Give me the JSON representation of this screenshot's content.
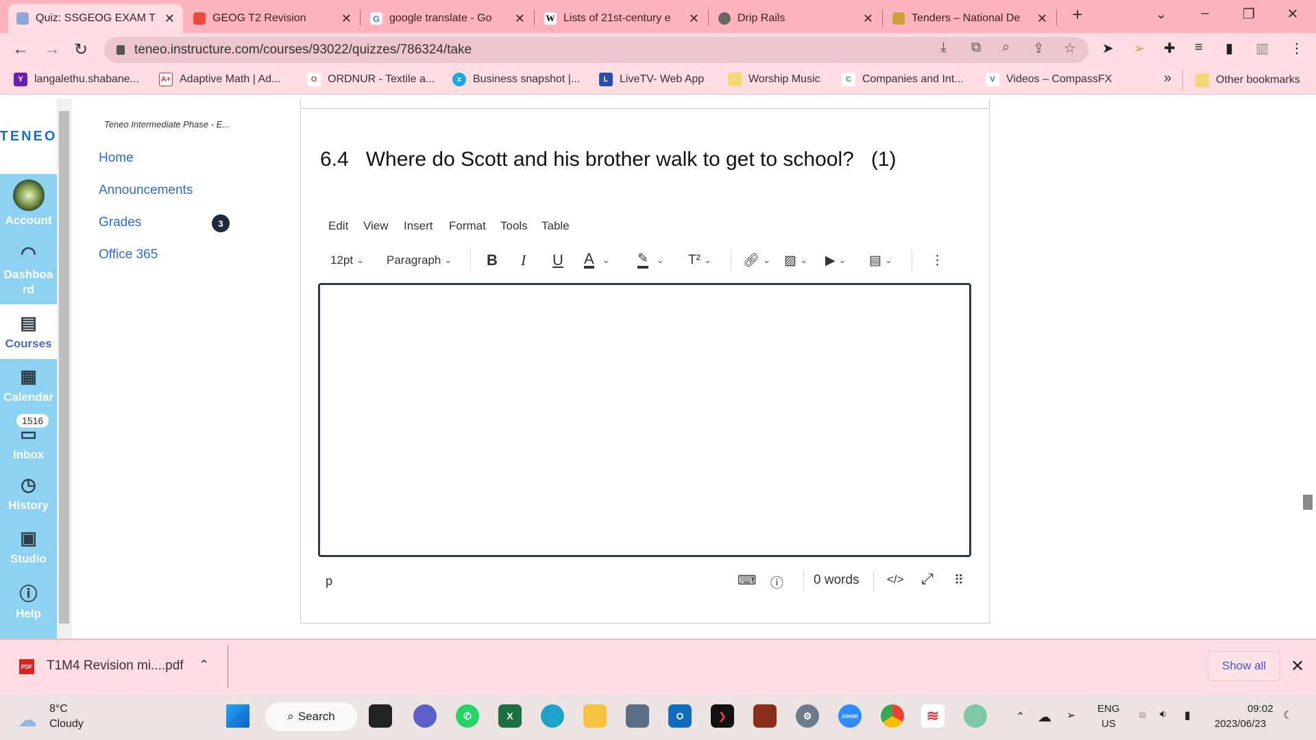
{
  "browser": {
    "tabs": [
      {
        "title": "Quiz: SSGEOG EXAM T",
        "active": true,
        "color": "#8fa7d8"
      },
      {
        "title": "GEOG T2 Revision",
        "active": false,
        "color": "#e84c3d"
      },
      {
        "title": "google translate - Go",
        "active": false,
        "color": "#4285f4"
      },
      {
        "title": "Lists of 21st-century e",
        "active": false,
        "color": "#ffffff"
      },
      {
        "title": "Drip Rails",
        "active": false,
        "color": "#666666"
      },
      {
        "title": "Tenders – National De",
        "active": false,
        "color": "#c9a13b"
      }
    ],
    "new_tab": "+",
    "url": "teneo.instructure.com/courses/93022/quizzes/786324/take",
    "bookmarks": [
      {
        "label": "langalethu.shabane...",
        "color": "#6b1fb1",
        "glyph": "Y"
      },
      {
        "label": "Adaptive Math | Ad...",
        "color": "#d32f2f",
        "glyph": "A+"
      },
      {
        "label": "ORDNUR - Textile a...",
        "color": "#8a5a3b",
        "glyph": "O"
      },
      {
        "label": "Business snapshot |...",
        "color": "#18a9e0",
        "glyph": "x"
      },
      {
        "label": "LiveTV- Web App",
        "color": "#2a4fb0",
        "glyph": "L"
      },
      {
        "label": "Worship Music",
        "color": "#f7d774",
        "glyph": ""
      },
      {
        "label": "Companies and Int...",
        "color": "#3da24a",
        "glyph": "C"
      },
      {
        "label": "Videos – CompassFX",
        "color": "#3a6fb0",
        "glyph": "V"
      }
    ],
    "more_bookmarks": "»",
    "other_bookmarks": "Other bookmarks"
  },
  "canvas": {
    "logo": "TENEO",
    "global_nav": [
      {
        "label": "Account",
        "icon": "avatar"
      },
      {
        "label": "Dashboard",
        "icon": "dashboard-icon"
      },
      {
        "label": "Courses",
        "icon": "courses-icon",
        "active": true
      },
      {
        "label": "Calendar",
        "icon": "calendar-icon"
      },
      {
        "label": "Inbox",
        "icon": "inbox-icon",
        "badge": "1516"
      },
      {
        "label": "History",
        "icon": "history-icon"
      },
      {
        "label": "Studio",
        "icon": "studio-icon"
      },
      {
        "label": "Help",
        "icon": "help-icon"
      }
    ],
    "course_title": "Teneo Intermediate Phase - E...",
    "course_nav": [
      {
        "label": "Home"
      },
      {
        "label": "Announcements"
      },
      {
        "label": "Grades",
        "badge": "3"
      },
      {
        "label": "Office 365"
      }
    ]
  },
  "question": {
    "number": "6.4",
    "text": "Where do Scott and his brother walk to get to school?",
    "marks": "(1)"
  },
  "editor": {
    "menus": [
      "Edit",
      "View",
      "Insert",
      "Format",
      "Tools",
      "Table"
    ],
    "font_size": "12pt",
    "block_format": "Paragraph",
    "content": "",
    "path": "p",
    "word_count": "0 words",
    "html_toggle": "</>"
  },
  "download_bar": {
    "file": "T1M4 Revision mi....pdf",
    "show_all": "Show all"
  },
  "taskbar": {
    "weather_temp": "8°C",
    "weather_desc": "Cloudy",
    "search": "Search",
    "lang": "ENG",
    "region": "US",
    "time": "09:02",
    "date": "2023/06/23"
  }
}
